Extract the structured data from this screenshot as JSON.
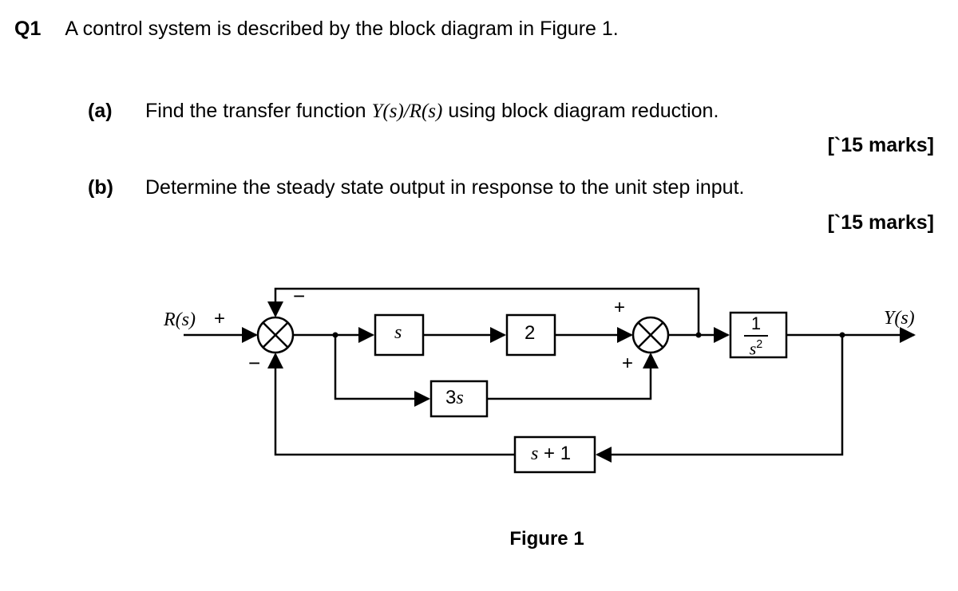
{
  "question": {
    "label": "Q1",
    "stem_prefix": "A control system is described by the block diagram in ",
    "stem_figref": "Figure 1",
    "stem_suffix": "."
  },
  "parts": {
    "a": {
      "label": "(a)",
      "text_prefix": "Find the transfer function ",
      "tf_expr": "Y(s)/R(s)",
      "text_suffix": " using block diagram reduction.",
      "marks": "[`15 marks]"
    },
    "b": {
      "label": "(b)",
      "text": "Determine the steady state output in response to the unit step input.",
      "marks": "[`15 marks]"
    }
  },
  "diagram": {
    "input_label": "R(s)",
    "output_label": "Y(s)",
    "sum1": {
      "top_sign": "−",
      "left_sign": "+",
      "bottom_sign": "−"
    },
    "sum2": {
      "top_sign": "+",
      "bottom_sign": "+"
    },
    "blocks": {
      "b_s": {
        "text": "s"
      },
      "b_2": {
        "text": "2"
      },
      "b_3s": {
        "text": "3s"
      },
      "b_sp1": {
        "text": "s + 1"
      },
      "b_frac": {
        "num": "1",
        "den_base": "s",
        "den_exp": "2"
      }
    },
    "caption": "Figure 1"
  }
}
